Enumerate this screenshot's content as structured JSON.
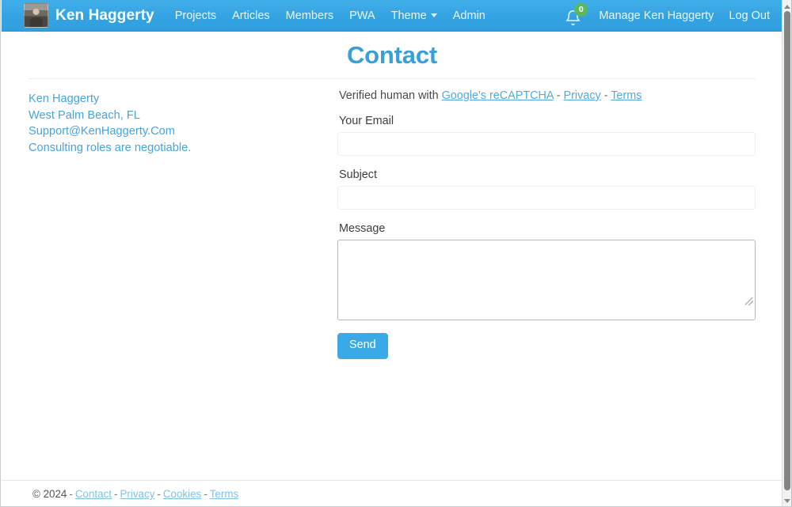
{
  "navbar": {
    "brand": "Ken Haggerty",
    "avatar_icon": "user-avatar-photo",
    "links": [
      {
        "label": "Projects"
      },
      {
        "label": "Articles"
      },
      {
        "label": "Members"
      },
      {
        "label": "PWA"
      },
      {
        "label": "Theme",
        "has_dropdown": true
      },
      {
        "label": "Admin"
      }
    ],
    "notifications": {
      "icon": "bell-icon",
      "count": "0",
      "badge_color": "#5cb85c"
    },
    "manage_label": "Manage Ken Haggerty",
    "logout_label": "Log Out",
    "background_color": "#33a3e2"
  },
  "page": {
    "title": "Contact",
    "title_color": "#3a9fd8"
  },
  "contact_info": [
    {
      "label": "Ken Haggerty"
    },
    {
      "label": "West Palm Beach, FL"
    },
    {
      "label": "Support@KenHaggerty.Com"
    },
    {
      "label": "Consulting roles are negotiable."
    }
  ],
  "captcha": {
    "prefix": "Verified human with",
    "recaptcha_link": "Google's reCAPTCHA",
    "sep1": "-",
    "privacy_link": "Privacy",
    "sep2": "-",
    "terms_link": "Terms"
  },
  "form": {
    "email": {
      "label": "Your Email",
      "value": "",
      "placeholder": ""
    },
    "subject": {
      "label": "Subject",
      "value": "",
      "placeholder": ""
    },
    "message": {
      "label": "Message",
      "value": "",
      "placeholder": ""
    },
    "submit_label": "Send",
    "submit_color": "#3aa9e8"
  },
  "footer": {
    "copyright": "© 2024",
    "sep": "-",
    "links": [
      {
        "label": "Contact"
      },
      {
        "label": "Privacy"
      },
      {
        "label": "Cookies"
      },
      {
        "label": "Terms"
      }
    ]
  }
}
